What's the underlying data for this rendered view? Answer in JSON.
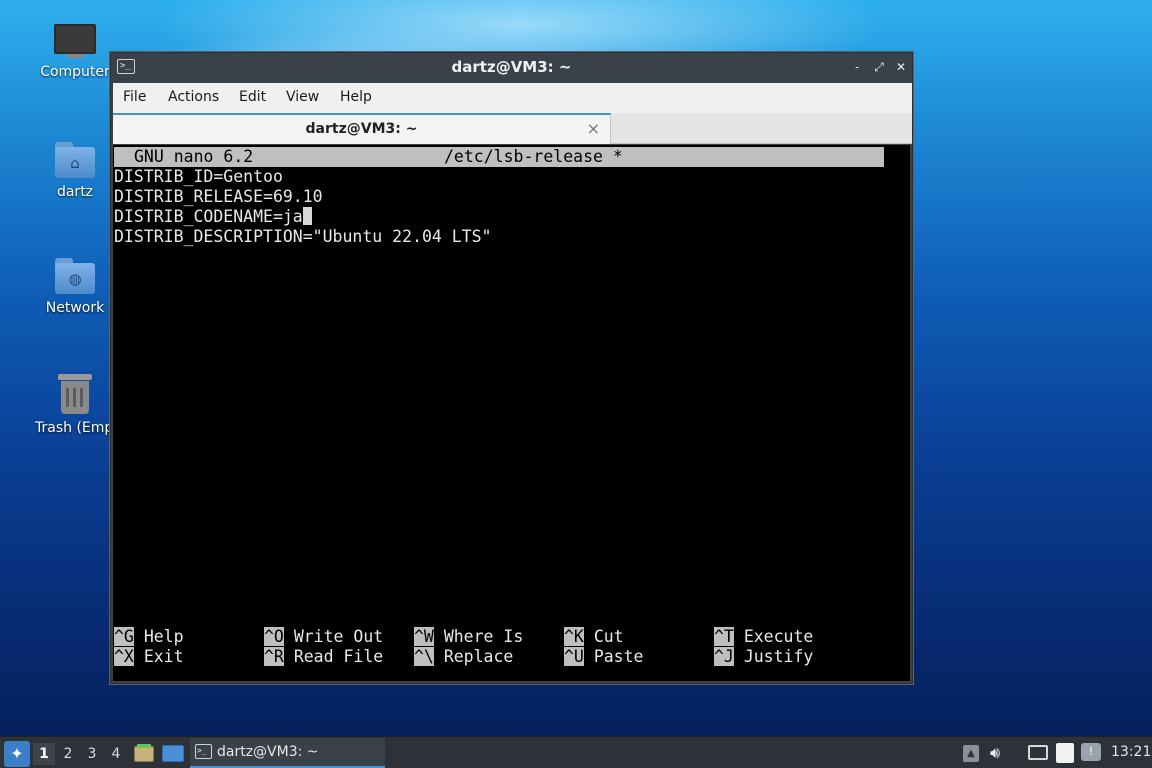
{
  "desktop": {
    "icons": [
      {
        "label": "Computer"
      },
      {
        "label": "dartz"
      },
      {
        "label": "Network"
      },
      {
        "label": "Trash (Empty)"
      }
    ]
  },
  "window": {
    "title": "dartz@VM3: ~",
    "menu": [
      "File",
      "Actions",
      "Edit",
      "View",
      "Help"
    ],
    "tab_label": "dartz@VM3: ~",
    "tab_close": "×",
    "controls": {
      "minimize": "˗",
      "maximize": "⤢",
      "close": "✕"
    }
  },
  "nano": {
    "version": "GNU nano 6.2",
    "filename": "/etc/lsb-release *",
    "lines": [
      "DISTRIB_ID=Gentoo",
      "DISTRIB_RELEASE=69.10",
      "DISTRIB_CODENAME=ja",
      "DISTRIB_DESCRIPTION=\"Ubuntu 22.04 LTS\""
    ],
    "shortcuts_row1": [
      {
        "key": "^G",
        "label": "Help"
      },
      {
        "key": "^O",
        "label": "Write Out"
      },
      {
        "key": "^W",
        "label": "Where Is"
      },
      {
        "key": "^K",
        "label": "Cut"
      },
      {
        "key": "^T",
        "label": "Execute"
      }
    ],
    "shortcuts_row2": [
      {
        "key": "^X",
        "label": "Exit"
      },
      {
        "key": "^R",
        "label": "Read File"
      },
      {
        "key": "^\\",
        "label": "Replace"
      },
      {
        "key": "^U",
        "label": "Paste"
      },
      {
        "key": "^J",
        "label": "Justify"
      }
    ]
  },
  "taskbar": {
    "workspaces": [
      "1",
      "2",
      "3",
      "4"
    ],
    "active_workspace": "1",
    "task_label": "dartz@VM3: ~",
    "clock": "13:21"
  },
  "colors": {
    "accent": "#4a90d9",
    "taskbar": "#2c3238",
    "titlebar": "#3b4148"
  }
}
